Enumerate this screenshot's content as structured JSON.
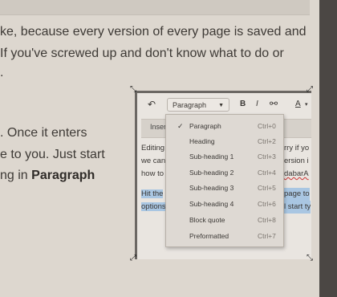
{
  "article": {
    "line1": "ke, because every version of every page is saved and",
    "line2": "If you've screwed up and don't know what to do or",
    "line3": ".",
    "line4": ". Once it enters",
    "line5": "e to you. Just start",
    "line6_prefix": "ng in ",
    "line6_bold": "Paragraph"
  },
  "toolbar": {
    "undo_glyph": "↶",
    "format_value": "Paragraph",
    "bold": "B",
    "italic": "I",
    "link_glyph": "⚯",
    "textstyle": "A",
    "textstyle_caret": "▾"
  },
  "insert_tab": "Inser",
  "editor_text": {
    "l1a": "Editing",
    "l1b": "rry if yo",
    "l2a": "we can",
    "l2b": "ersion i",
    "l3a": "how to",
    "l3b": "dabarA",
    "l4a": "Hit the",
    "l4b": "page to",
    "l5a": "options",
    "l5b": "l start ty"
  },
  "format_menu": {
    "items": [
      {
        "label": "Paragraph",
        "shortcut": "Ctrl+0",
        "checked": true
      },
      {
        "label": "Heading",
        "shortcut": "Ctrl+2",
        "checked": false
      },
      {
        "label": "Sub-heading 1",
        "shortcut": "Ctrl+3",
        "checked": false
      },
      {
        "label": "Sub-heading 2",
        "shortcut": "Ctrl+4",
        "checked": false
      },
      {
        "label": "Sub-heading 3",
        "shortcut": "Ctrl+5",
        "checked": false
      },
      {
        "label": "Sub-heading 4",
        "shortcut": "Ctrl+6",
        "checked": false
      },
      {
        "label": "Block quote",
        "shortcut": "Ctrl+8",
        "checked": false
      },
      {
        "label": "Preformatted",
        "shortcut": "Ctrl+7",
        "checked": false
      }
    ],
    "check_glyph": "✓"
  },
  "colors": {
    "background": "#ddd7cf",
    "selection": "#a9c6e2",
    "dark_strip": "#4b4744"
  }
}
